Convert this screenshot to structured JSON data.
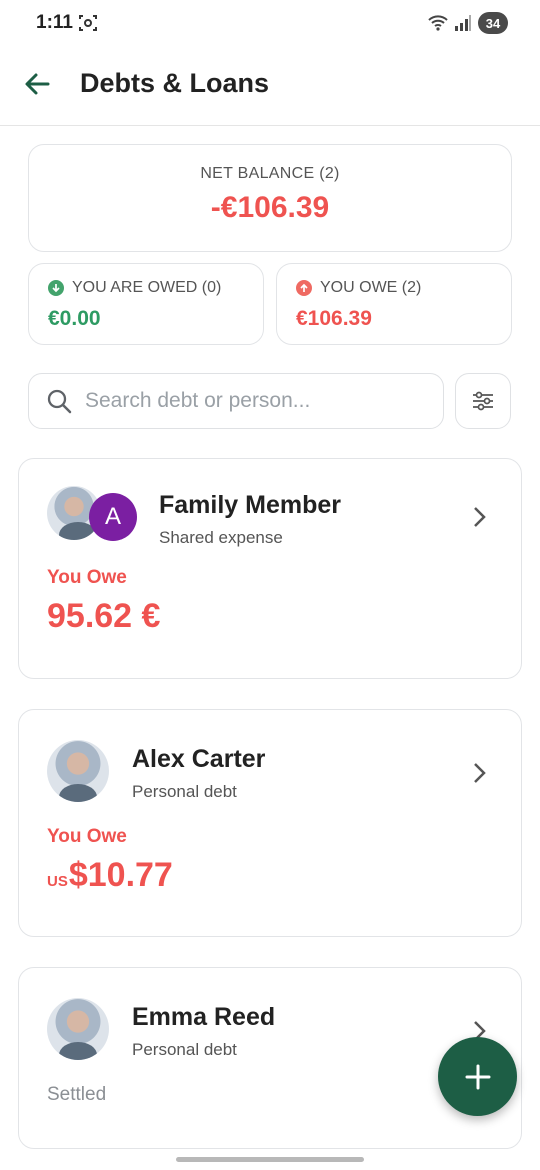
{
  "status_bar": {
    "time": "1:11",
    "battery": "34"
  },
  "header": {
    "title": "Debts & Loans"
  },
  "summary": {
    "net_label": "NET BALANCE (2)",
    "net_value": "-€106.39",
    "owed_label": "YOU ARE OWED (0)",
    "owed_value": "€0.00",
    "owe_label": "YOU OWE (2)",
    "owe_value": "€106.39"
  },
  "search": {
    "placeholder": "Search debt or person..."
  },
  "debts": [
    {
      "avatar_letter": "A",
      "name": "Family Member",
      "subtitle": "Shared expense",
      "status": "You Owe",
      "amount": "95.62 €"
    },
    {
      "name": "Alex Carter",
      "subtitle": "Personal debt",
      "status": "You Owe",
      "currency_prefix": "US",
      "amount": "$10.77"
    },
    {
      "name": "Emma Reed",
      "subtitle": "Personal debt",
      "status": "Settled"
    }
  ],
  "colors": {
    "accent": "#1d5e45",
    "negative": "#ef5350",
    "positive": "#2e9b63"
  }
}
